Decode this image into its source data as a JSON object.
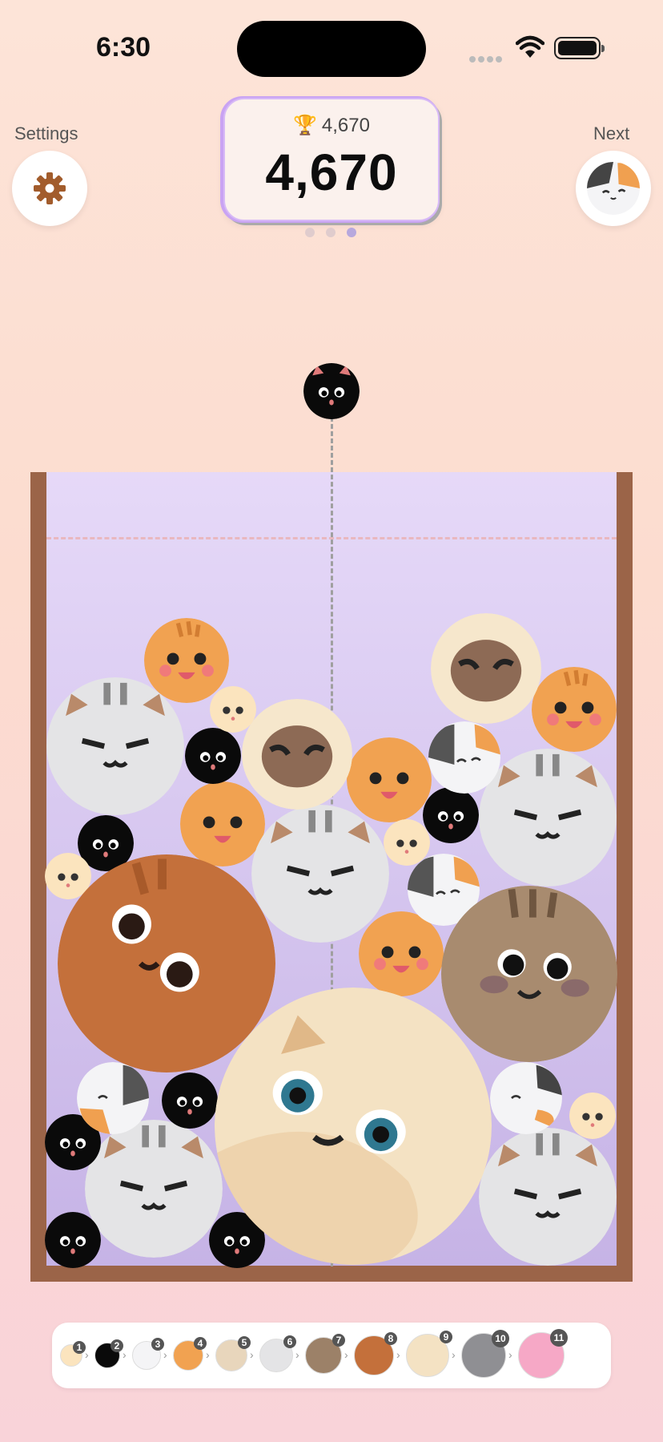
{
  "status": {
    "time": "6:30"
  },
  "header": {
    "settings_label": "Settings",
    "next_label": "Next",
    "best_score": "4,670",
    "score": "4,670",
    "page_dots": 3,
    "active_dot": 2
  },
  "icons": {
    "settings": "gear-icon",
    "trophy": "trophy-icon",
    "wifi": "wifi-icon",
    "battery": "battery-icon"
  },
  "colors": {
    "wall": "#9b6448",
    "accent": "#c9a3f3",
    "gear": "#a25c2c"
  },
  "legend": {
    "items": [
      {
        "level": "1",
        "cat": "cream-kitten"
      },
      {
        "level": "2",
        "cat": "black-kitten"
      },
      {
        "level": "3",
        "cat": "calico-kitten"
      },
      {
        "level": "4",
        "cat": "orange-tabby"
      },
      {
        "level": "5",
        "cat": "siamese"
      },
      {
        "level": "6",
        "cat": "grey-tabby"
      },
      {
        "level": "7",
        "cat": "brown-tabby"
      },
      {
        "level": "8",
        "cat": "ginger-cat"
      },
      {
        "level": "9",
        "cat": "cream-cat"
      },
      {
        "level": "10",
        "cat": "dark-grey-tabby"
      },
      {
        "level": "11",
        "cat": "pink-cat"
      }
    ]
  }
}
